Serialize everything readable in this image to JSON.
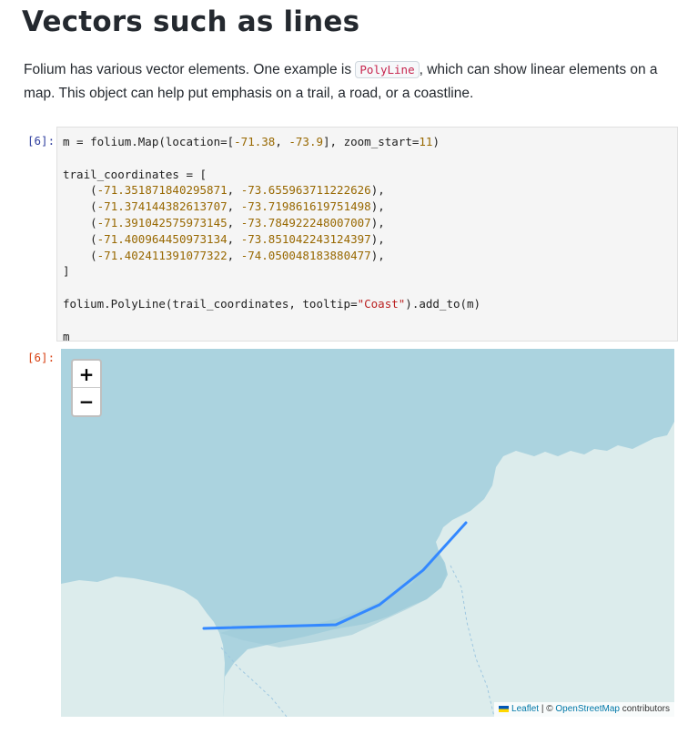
{
  "section": {
    "title": "Vectors such as lines",
    "para_before": "Folium has various vector elements. One example is ",
    "para_code": "PolyLine",
    "para_after": ", which can show linear elements on a map. This object can help put emphasis on a trail, a road, or a coastline."
  },
  "cell": {
    "in_prompt": "[6]:",
    "out_prompt": "[6]:",
    "code": {
      "l1_a": "m = folium.Map(location=[",
      "l1_lat": "-71.38",
      "l1_sep": ", ",
      "l1_lon": "-73.9",
      "l1_b": "], zoom_start=",
      "l1_zoom": "11",
      "l1_c": ")",
      "l3": "trail_coordinates = [",
      "coords": [
        [
          "-71.351871840295871",
          "-73.655963711222626"
        ],
        [
          "-71.374144382613707",
          "-73.719861619751498"
        ],
        [
          "-71.391042575973145",
          "-73.784922248007007"
        ],
        [
          "-71.400964450973134",
          "-73.851042243124397"
        ],
        [
          "-71.402411391077322",
          "-74.050048183880477"
        ]
      ],
      "close": "]",
      "poly_a": "folium.PolyLine(trail_coordinates, tooltip=",
      "poly_str": "\"Coast\"",
      "poly_b": ").add_to(m)",
      "last": "m"
    }
  },
  "map": {
    "zoom_in": "+",
    "zoom_out": "−",
    "attrib_leaflet": "Leaflet",
    "attrib_sep": " | © ",
    "attrib_osm": "OpenStreetMap",
    "attrib_tail": " contributors",
    "colors": {
      "water": "#abd3df",
      "land": "#dcecec",
      "polyline": "#3388ff"
    }
  }
}
